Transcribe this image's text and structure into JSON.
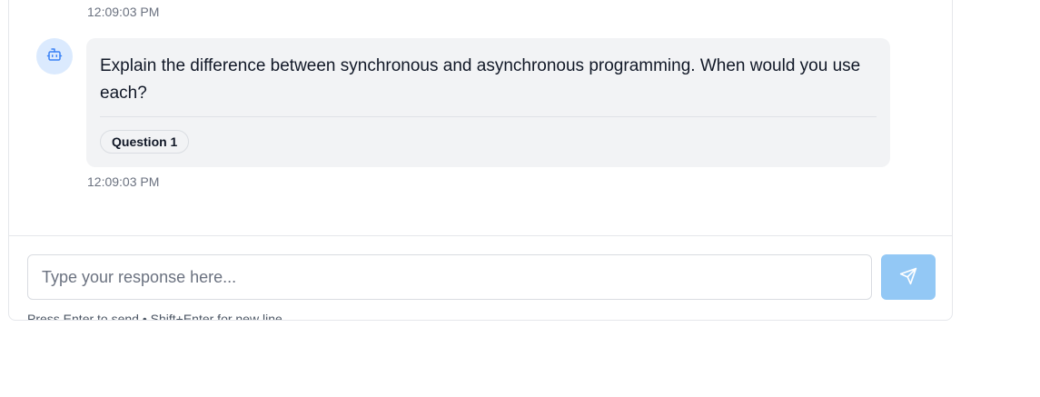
{
  "messages": [
    {
      "timestamp": "12:09:03 PM"
    },
    {
      "sender_icon": "bot-icon",
      "text": "Explain the difference between synchronous and asynchronous programming. When would you use each?",
      "tag": "Question 1",
      "timestamp": "12:09:03 PM"
    }
  ],
  "composer": {
    "placeholder": "Type your response here...",
    "value": "",
    "send_icon": "send-icon",
    "hint": "Press Enter to send • Shift+Enter for new line"
  },
  "colors": {
    "avatar_bg": "#dbeafe",
    "avatar_icon": "#3b82f6",
    "bubble_bg": "#f2f3f5",
    "send_button_bg": "#93c8f5",
    "timestamp_text": "#6b7280"
  }
}
